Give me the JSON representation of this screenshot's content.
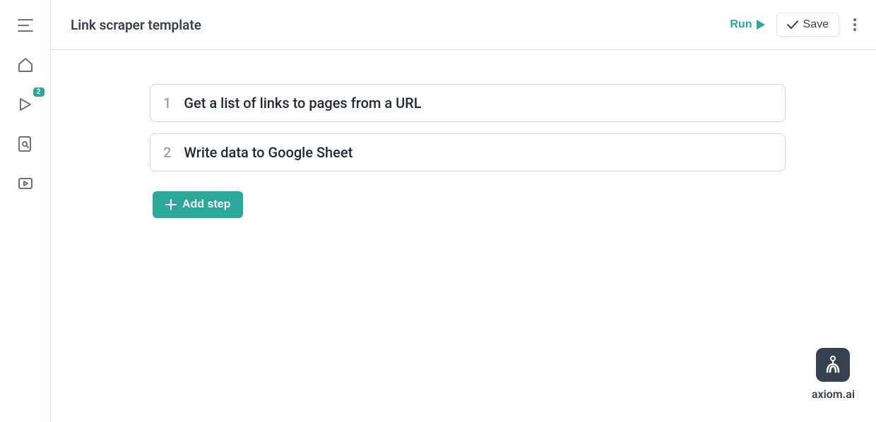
{
  "header": {
    "title": "Link scraper template",
    "run_label": "Run",
    "save_label": "Save"
  },
  "sidebar": {
    "badge_count": "2"
  },
  "steps": [
    {
      "number": "1",
      "title": "Get a list of links to pages from a URL"
    },
    {
      "number": "2",
      "title": "Write data to Google Sheet"
    }
  ],
  "actions": {
    "add_step_label": "Add step"
  },
  "brand": {
    "name": "axiom.ai"
  },
  "colors": {
    "accent": "#2ca89a",
    "text_primary": "#374151",
    "text_secondary": "#9ca3af",
    "border": "#e5e7eb"
  }
}
